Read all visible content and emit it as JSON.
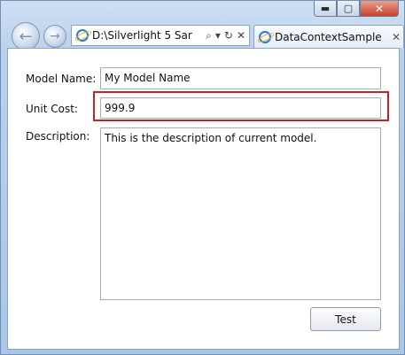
{
  "window": {
    "minimize_glyph": "▬",
    "maximize_glyph": "▢",
    "close_glyph": "✕"
  },
  "nav": {
    "back_glyph": "←",
    "forward_glyph": "→",
    "address_text": "D:\\Silverlight 5 Sar",
    "search_glyph": "⌕",
    "dropdown_glyph": "▾",
    "refresh_glyph": "↻",
    "stop_glyph": "✕"
  },
  "tab": {
    "title": "DataContextSample",
    "close_glyph": "✕"
  },
  "form": {
    "model_name_label": "Model Name:",
    "model_name_value": "My Model Name",
    "unit_cost_label": "Unit Cost:",
    "unit_cost_value": "999.9",
    "description_label": "Description:",
    "description_value": "This is the description of current model.",
    "test_button_label": "Test"
  },
  "colors": {
    "highlight": "#cc1f1f",
    "accent": "#2b7bd6"
  }
}
